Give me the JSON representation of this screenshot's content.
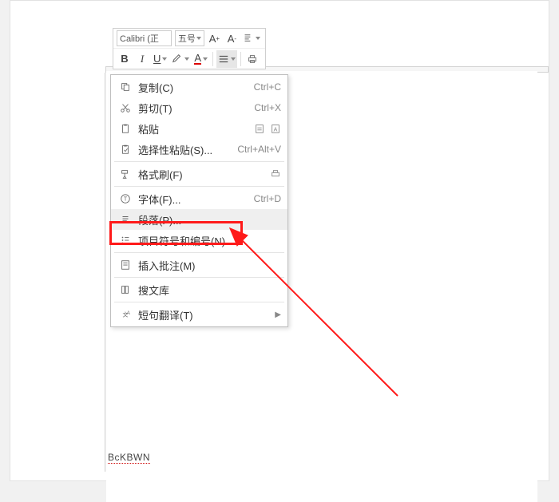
{
  "floater": {
    "font_name": "Calibri (正",
    "font_size": "五号",
    "row2": {
      "bold": "B",
      "italic": "I",
      "underline": "U",
      "hl": "🖍",
      "font_color": "A"
    }
  },
  "menu": {
    "copy": {
      "label": "复制(C)",
      "shortcut": "Ctrl+C"
    },
    "cut": {
      "label": "剪切(T)",
      "shortcut": "Ctrl+X"
    },
    "paste": {
      "label": "粘贴"
    },
    "paste_spec": {
      "label": "选择性粘贴(S)...",
      "shortcut": "Ctrl+Alt+V"
    },
    "format_p": {
      "label": "格式刷(F)"
    },
    "font": {
      "label": "字体(F)...",
      "shortcut": "Ctrl+D"
    },
    "paragraph": {
      "label": "段落(P)..."
    },
    "bullets": {
      "label": "项目符号和编号(N)..."
    },
    "comment": {
      "label": "插入批注(M)"
    },
    "soutext": {
      "label": "搜文库"
    },
    "translate": {
      "label": "短句翻译(T)"
    }
  },
  "watermark": "BcKBWN"
}
